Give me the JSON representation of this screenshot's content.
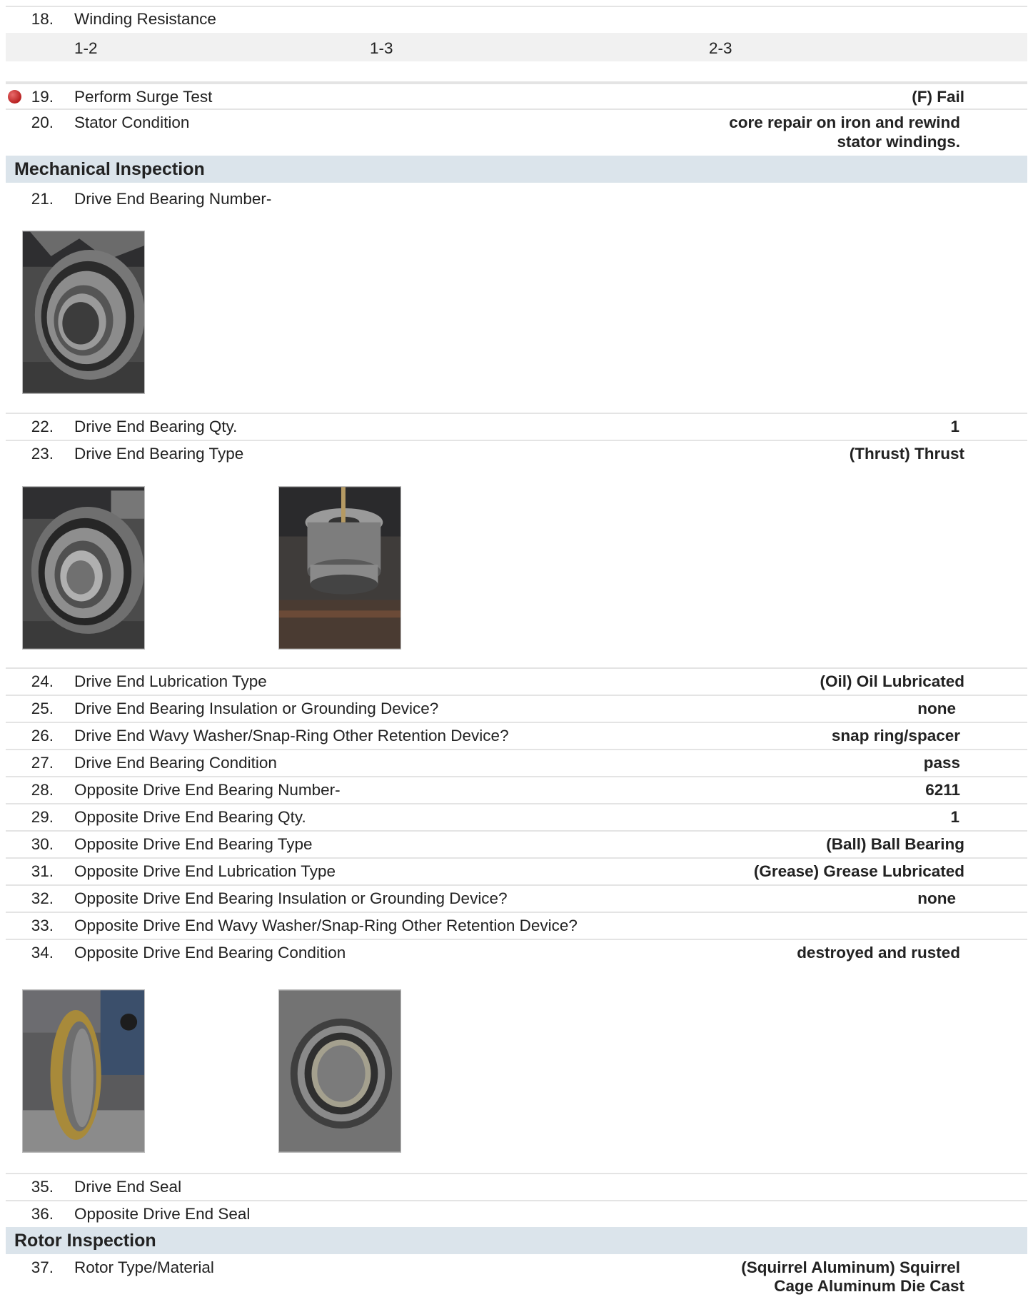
{
  "items": {
    "i18": {
      "num": "18.",
      "label": "Winding Resistance"
    },
    "i18_cols": {
      "c1": "1-2",
      "c2": "1-3",
      "c3": "2-3"
    },
    "i19": {
      "num": "19.",
      "label": "Perform Surge Test",
      "value": "(F) Fail"
    },
    "i20": {
      "num": "20.",
      "label": "Stator Condition",
      "value_line1": "core repair on iron and rewind",
      "value_line2": "stator windings."
    },
    "sec_mech": "Mechanical Inspection",
    "i21": {
      "num": "21.",
      "label": "Drive End Bearing Number-"
    },
    "i22": {
      "num": "22.",
      "label": "Drive End Bearing Qty.",
      "value": "1"
    },
    "i23": {
      "num": "23.",
      "label": "Drive End Bearing Type",
      "value": "(Thrust) Thrust"
    },
    "i24": {
      "num": "24.",
      "label": "Drive End Lubrication Type",
      "value": "(Oil) Oil Lubricated"
    },
    "i25": {
      "num": "25.",
      "label": "Drive End Bearing Insulation or Grounding Device?",
      "value": "none"
    },
    "i26": {
      "num": "26.",
      "label": "Drive End Wavy Washer/Snap-Ring Other Retention Device?",
      "value": "snap ring/spacer"
    },
    "i27": {
      "num": "27.",
      "label": "Drive End Bearing Condition",
      "value": "pass"
    },
    "i28": {
      "num": "28.",
      "label": "Opposite Drive End Bearing Number-",
      "value": "6211"
    },
    "i29": {
      "num": "29.",
      "label": "Opposite Drive End Bearing Qty.",
      "value": "1"
    },
    "i30": {
      "num": "30.",
      "label": "Opposite Drive End Bearing Type",
      "value": "(Ball) Ball Bearing"
    },
    "i31": {
      "num": "31.",
      "label": "Opposite Drive End Lubrication Type",
      "value": "(Grease) Grease Lubricated"
    },
    "i32": {
      "num": "32.",
      "label": "Opposite Drive End Bearing Insulation or Grounding Device?",
      "value": "none"
    },
    "i33": {
      "num": "33.",
      "label": "Opposite Drive End Wavy Washer/Snap-Ring Other Retention Device?"
    },
    "i34": {
      "num": "34.",
      "label": "Opposite Drive End Bearing Condition",
      "value": "destroyed and rusted"
    },
    "i35": {
      "num": "35.",
      "label": "Drive End Seal"
    },
    "i36": {
      "num": "36.",
      "label": "Opposite Drive End Seal"
    },
    "sec_rotor": "Rotor Inspection",
    "i37": {
      "num": "37.",
      "label": "Rotor Type/Material",
      "value_line1": "(Squirrel Aluminum) Squirrel",
      "value_line2": "Cage Aluminum Die Cast"
    }
  },
  "colors": {
    "section_bg": "#dbe4eb",
    "fail_flag": "#c62828",
    "divider": "#e4e4e4"
  },
  "photos": {
    "p21": "bearing-photo",
    "p23a": "bearing-photo",
    "p23b": "thrust-bearing-assembly-photo",
    "p34a": "outer-race-rusted-photo",
    "p34b": "ball-bearing-photo"
  }
}
